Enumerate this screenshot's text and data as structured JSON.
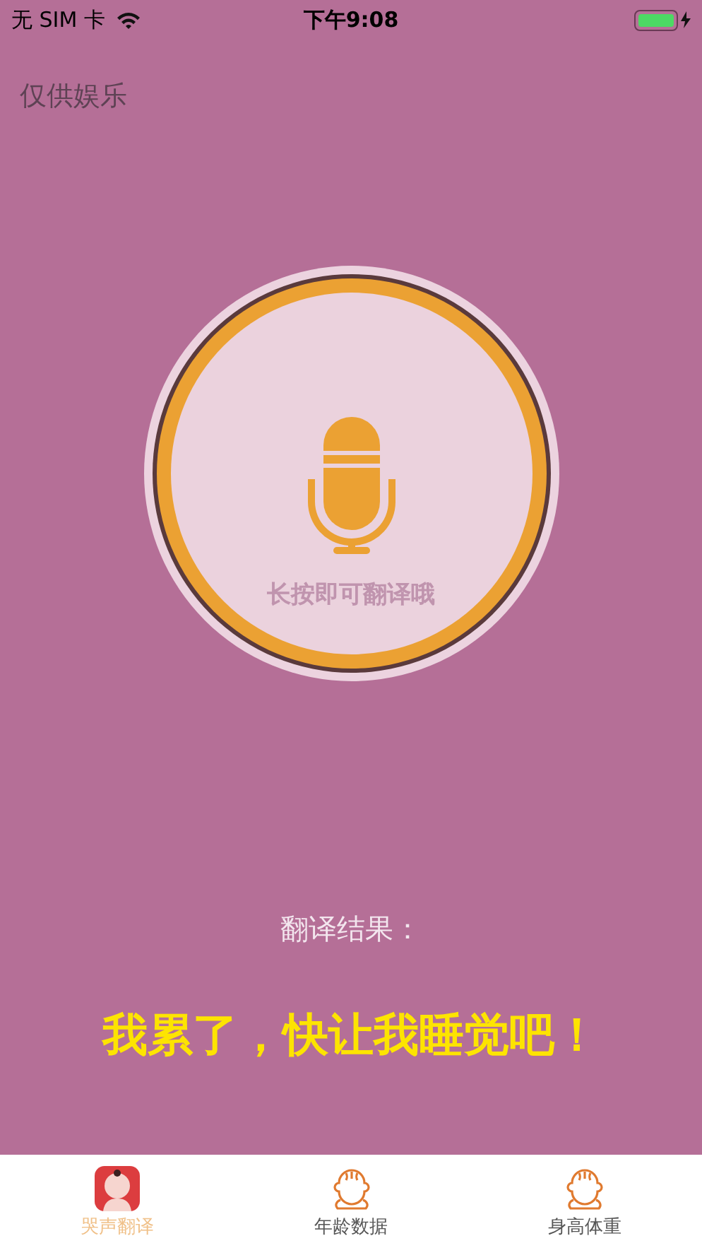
{
  "status_bar": {
    "carrier": "无 SIM 卡",
    "time": "下午9:08"
  },
  "header": {
    "title": "仅供娱乐"
  },
  "record_button": {
    "hint": "长按即可翻译哦"
  },
  "result": {
    "label": "翻译结果：",
    "text": "我累了，快让我睡觉吧！"
  },
  "tab_bar": [
    {
      "label": "哭声翻译",
      "selected": true
    },
    {
      "label": "年龄数据",
      "selected": false
    },
    {
      "label": "身高体重",
      "selected": false
    }
  ]
}
